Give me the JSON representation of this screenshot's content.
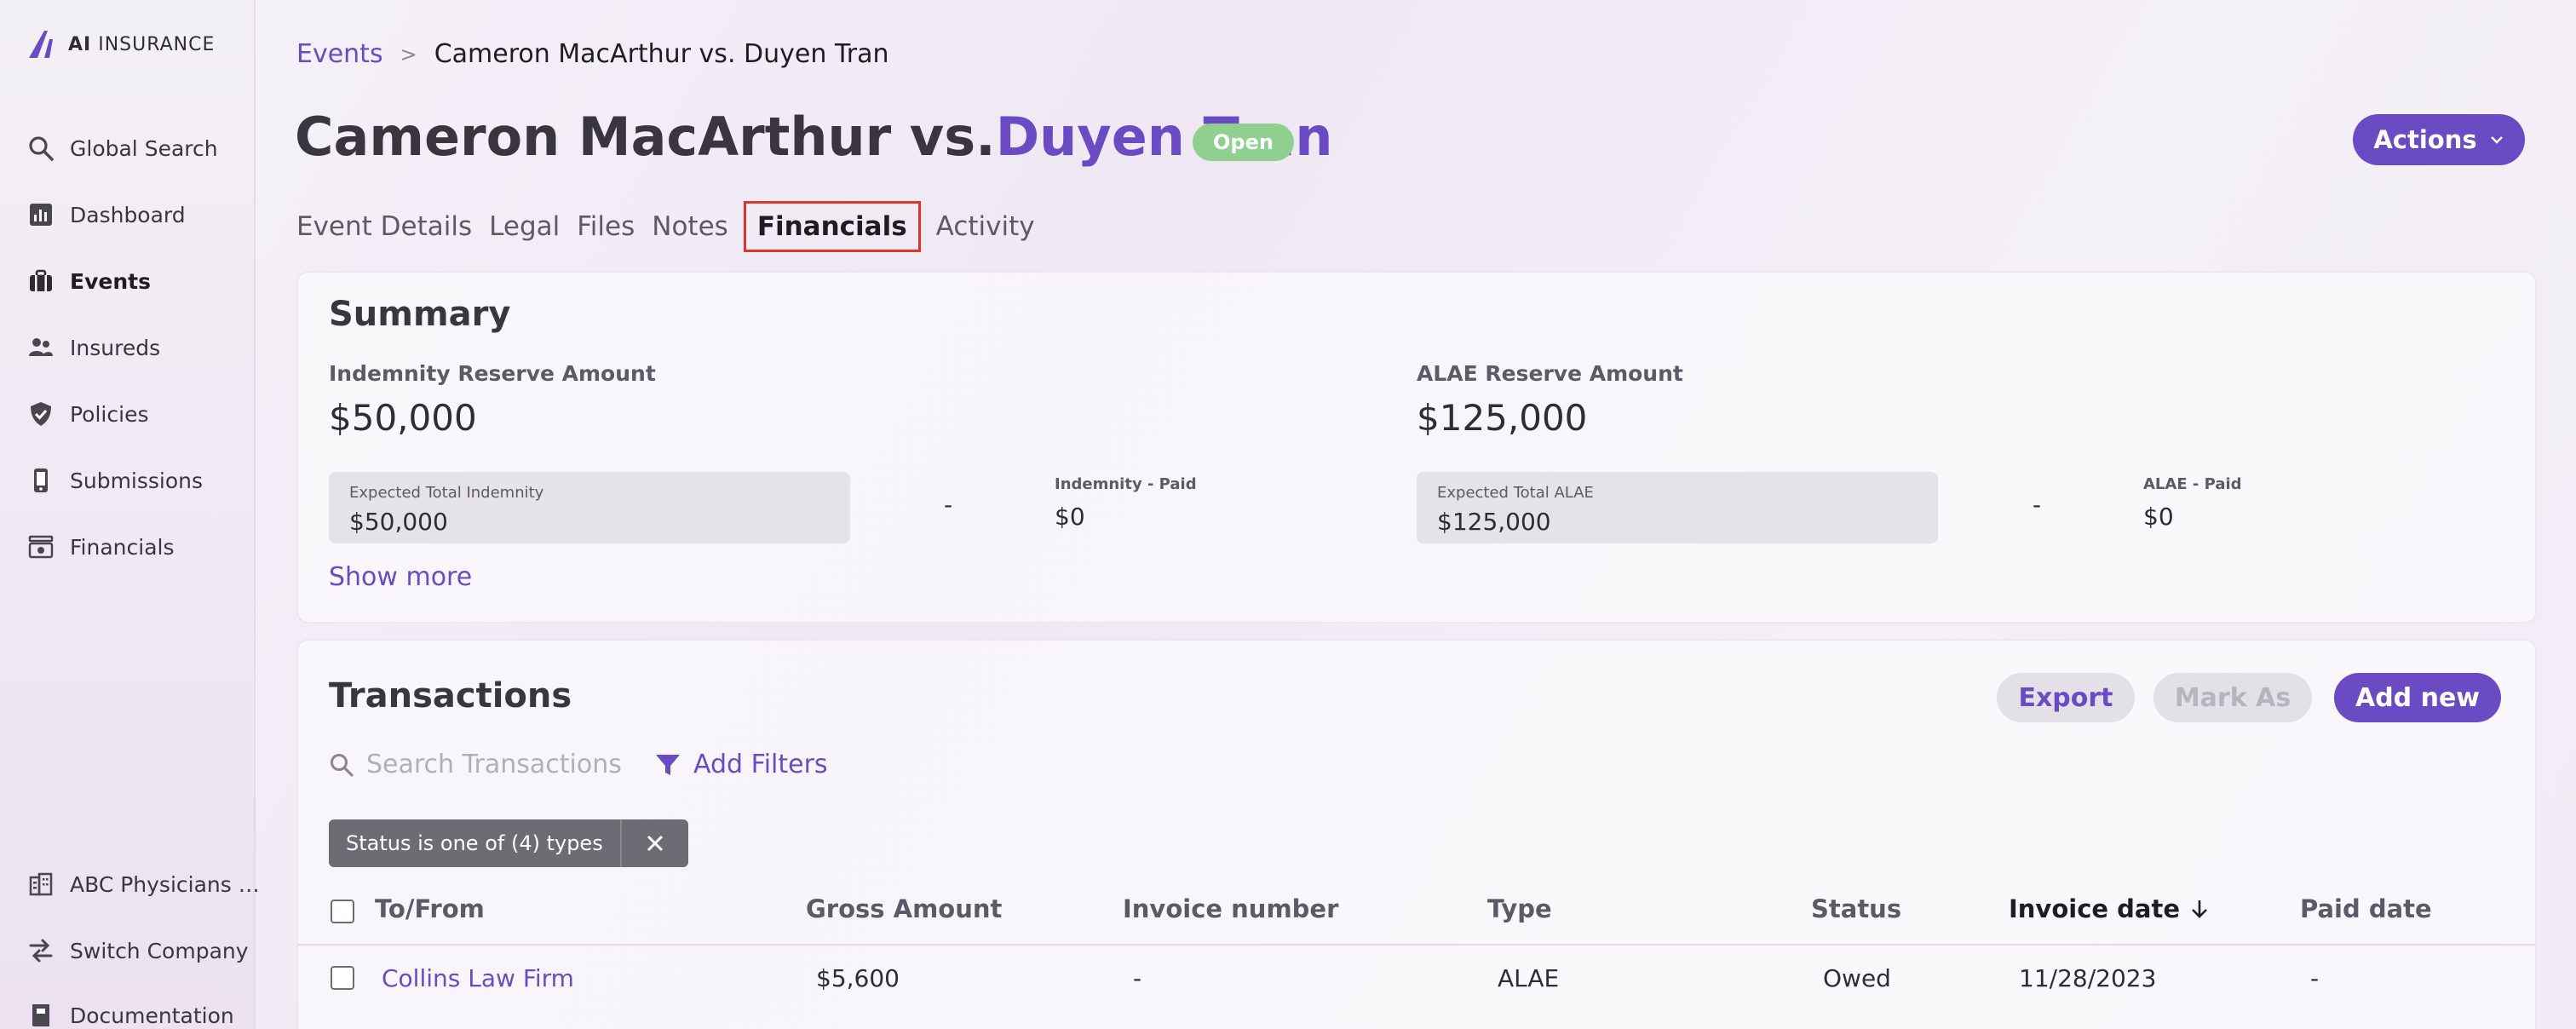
{
  "brand": {
    "logo_bold": "AI",
    "logo_rest": " INSURANCE"
  },
  "sidebar": {
    "items": [
      {
        "label": "Global Search",
        "icon": "search-icon"
      },
      {
        "label": "Dashboard",
        "icon": "dashboard-icon"
      },
      {
        "label": "Events",
        "icon": "briefcase-icon",
        "active": true
      },
      {
        "label": "Insureds",
        "icon": "users-icon"
      },
      {
        "label": "Policies",
        "icon": "shield-icon"
      },
      {
        "label": "Submissions",
        "icon": "mobile-icon"
      },
      {
        "label": "Financials",
        "icon": "money-icon"
      }
    ],
    "bottom": [
      {
        "label": "ABC Physicians …",
        "icon": "building-icon"
      },
      {
        "label": "Switch Company",
        "icon": "switch-icon"
      },
      {
        "label": "Documentation",
        "icon": "book-icon"
      }
    ]
  },
  "breadcrumb": {
    "parent": "Events",
    "separator": ">",
    "current": "Cameron MacArthur vs. Duyen Tran"
  },
  "title": {
    "part1": "Cameron MacArthur vs. ",
    "part2": "Duyen Tran"
  },
  "status_badge": "Open",
  "actions_label": "Actions",
  "tabs": [
    {
      "label": "Event Details"
    },
    {
      "label": "Legal"
    },
    {
      "label": "Files"
    },
    {
      "label": "Notes"
    },
    {
      "label": "Financials",
      "active": true
    },
    {
      "label": "Activity"
    }
  ],
  "summary": {
    "title": "Summary",
    "indemnity": {
      "reserve_label": "Indemnity Reserve Amount",
      "reserve_amount": "$50,000",
      "expected_label": "Expected Total Indemnity",
      "expected_value": "$50,000",
      "dash": "-",
      "paid_label": "Indemnity - Paid",
      "paid_value": "$0"
    },
    "alae": {
      "reserve_label": "ALAE Reserve Amount",
      "reserve_amount": "$125,000",
      "expected_label": "Expected Total ALAE",
      "expected_value": "$125,000",
      "dash": "-",
      "paid_label": "ALAE - Paid",
      "paid_value": "$0"
    },
    "show_more": "Show more"
  },
  "transactions": {
    "title": "Transactions",
    "export_label": "Export",
    "mark_as_label": "Mark As",
    "add_new_label": "Add new",
    "search_placeholder": "Search Transactions",
    "add_filters_label": "Add Filters",
    "filter_chip": "Status is one of (4) types",
    "columns": {
      "to_from": "To/From",
      "gross_amount": "Gross Amount",
      "invoice_number": "Invoice number",
      "type": "Type",
      "status": "Status",
      "invoice_date": "Invoice date",
      "paid_date": "Paid date"
    },
    "rows": [
      {
        "to_from": "Collins Law Firm",
        "gross_amount": "$5,600",
        "invoice_number": "-",
        "type": "ALAE",
        "status": "Owed",
        "invoice_date": "11/28/2023",
        "paid_date": "-"
      }
    ]
  },
  "colors": {
    "accent": "#6a4bc4",
    "open_badge": "#8fd08f",
    "highlight_border": "#e0352b"
  }
}
